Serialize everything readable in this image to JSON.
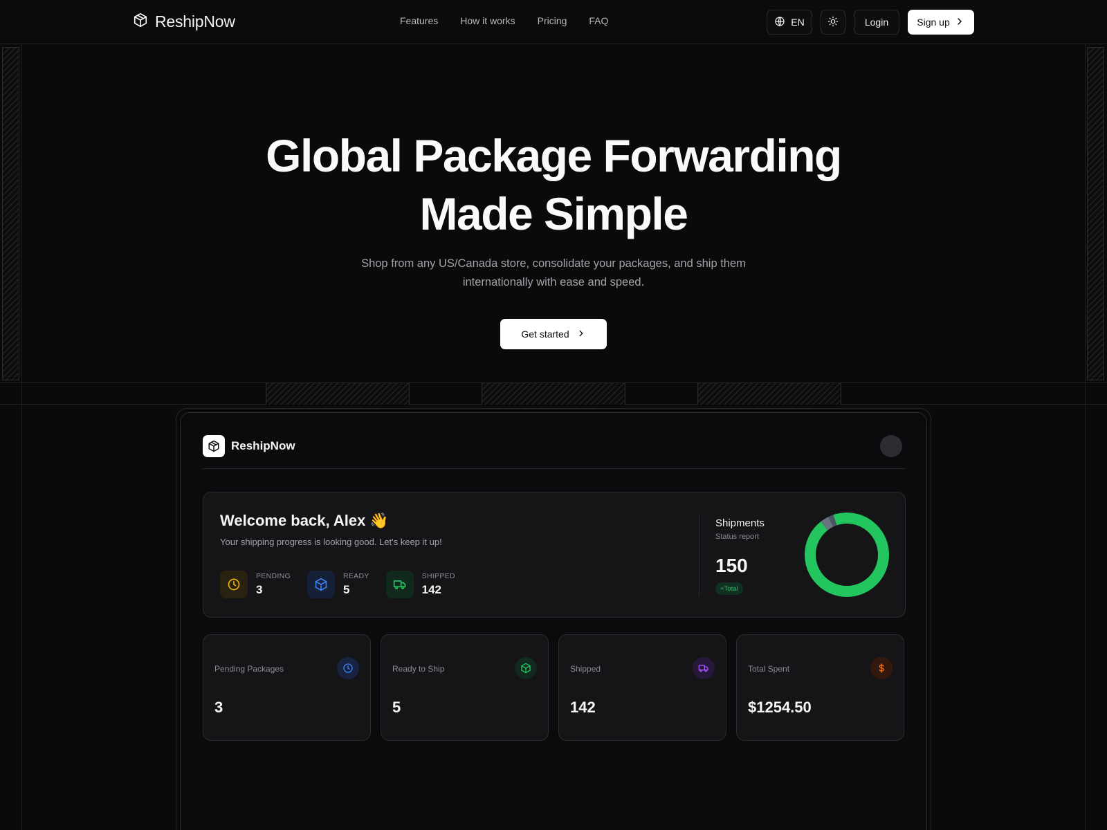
{
  "nav": {
    "brand": "ReshipNow",
    "links": [
      "Features",
      "How it works",
      "Pricing",
      "FAQ"
    ],
    "language": "EN",
    "login": "Login",
    "signup": "Sign up"
  },
  "hero": {
    "title_line1": "Global Package Forwarding",
    "title_line2": "Made Simple",
    "subtitle": "Shop from any US/Canada store, consolidate your packages, and ship them internationally with ease and speed.",
    "cta": "Get started"
  },
  "dashboard": {
    "brand": "ReshipNow",
    "welcome": {
      "title": "Welcome back, Alex 👋",
      "subtitle": "Your shipping progress is looking good. Let's keep it up!",
      "stats": [
        {
          "label": "PENDING",
          "value": "3",
          "icon": "clock-icon",
          "color": "#eab308"
        },
        {
          "label": "READY",
          "value": "5",
          "icon": "box-icon",
          "color": "#3b82f6"
        },
        {
          "label": "SHIPPED",
          "value": "142",
          "icon": "truck-icon",
          "color": "#22c55e"
        }
      ]
    },
    "shipments": {
      "title": "Shipments",
      "subtitle": "Status report",
      "total": "150",
      "badge": "+Total",
      "chart_segments": [
        {
          "value": 142,
          "color": "#22c55e"
        },
        {
          "value": 5,
          "color": "#6b7280"
        },
        {
          "value": 3,
          "color": "#4b5563"
        }
      ]
    },
    "cards": [
      {
        "label": "Pending Packages",
        "value": "3",
        "icon": "clock-icon",
        "color": "#3b82f6",
        "bg": "#17233f"
      },
      {
        "label": "Ready to Ship",
        "value": "5",
        "icon": "box-icon",
        "color": "#22c55e",
        "bg": "#11291e"
      },
      {
        "label": "Shipped",
        "value": "142",
        "icon": "truck-icon",
        "color": "#a855f7",
        "bg": "#26183a"
      },
      {
        "label": "Total Spent",
        "value": "$1254.50",
        "icon": "dollar-icon",
        "color": "#f97316",
        "bg": "#33190d"
      }
    ]
  },
  "colors": {
    "background": "#0a0a0b",
    "accent_green": "#22c55e"
  }
}
